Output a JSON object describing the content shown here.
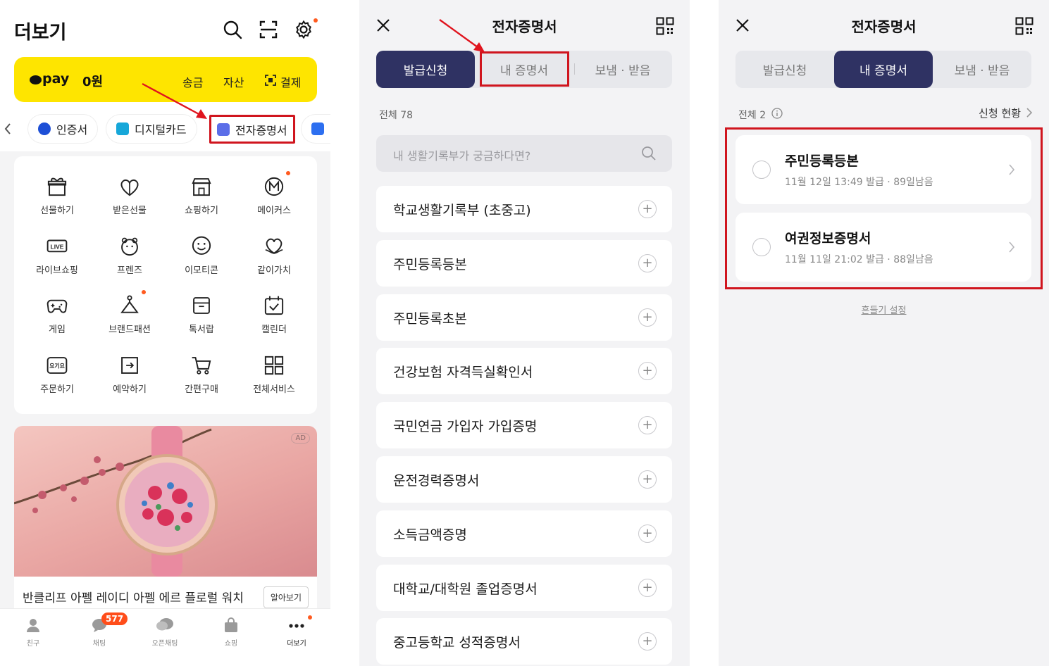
{
  "panel1": {
    "title": "더보기",
    "pay": {
      "logo": "pay",
      "amount": "0원",
      "links": [
        "송금",
        "자산",
        "결제"
      ]
    },
    "shortcuts": [
      "인증서",
      "디지털카드",
      "전자증명서"
    ],
    "grid": [
      {
        "label": "선물하기",
        "icon": "gift-icon"
      },
      {
        "label": "받은선물",
        "icon": "received-gift-icon"
      },
      {
        "label": "쇼핑하기",
        "icon": "store-icon"
      },
      {
        "label": "메이커스",
        "icon": "makers-icon"
      },
      {
        "label": "라이브쇼핑",
        "icon": "live-icon"
      },
      {
        "label": "프렌즈",
        "icon": "friends-icon"
      },
      {
        "label": "이모티콘",
        "icon": "emoticon-icon"
      },
      {
        "label": "같이가치",
        "icon": "heart-hands-icon"
      },
      {
        "label": "게임",
        "icon": "gamepad-icon"
      },
      {
        "label": "브랜드패션",
        "icon": "hanger-icon"
      },
      {
        "label": "톡서랍",
        "icon": "drawer-icon"
      },
      {
        "label": "캘린더",
        "icon": "calendar-icon"
      },
      {
        "label": "주문하기",
        "icon": "order-icon"
      },
      {
        "label": "예약하기",
        "icon": "reservation-icon"
      },
      {
        "label": "간편구매",
        "icon": "cart-icon"
      },
      {
        "label": "전체서비스",
        "icon": "all-services-icon"
      }
    ],
    "ad": {
      "badge": "AD",
      "text": "반클리프 아펠 레이디 아펠 에르 플로럴 워치",
      "button": "알아보기"
    },
    "tabs": [
      "친구",
      "채팅",
      "오픈채팅",
      "쇼핑",
      "더보기"
    ],
    "chat_badge": "577"
  },
  "panel2": {
    "title": "전자증명서",
    "segments": [
      "발급신청",
      "내 증명서",
      "보냄 · 받음"
    ],
    "count": "전체 78",
    "search_placeholder": "내 생활기록부가 궁금하다면?",
    "items": [
      "학교생활기록부 (초중고)",
      "주민등록등본",
      "주민등록초본",
      "건강보험 자격득실확인서",
      "국민연금 가입자 가입증명",
      "운전경력증명서",
      "소득금액증명",
      "대학교/대학원 졸업증명서",
      "중고등학교 성적증명서"
    ]
  },
  "panel3": {
    "title": "전자증명서",
    "segments": [
      "발급신청",
      "내 증명서",
      "보냄 · 받음"
    ],
    "count": "전체 2",
    "status_link": "신청 현황",
    "certs": [
      {
        "name": "주민등록등본",
        "sub": "11월 12일 13:49 발급 · 89일남음"
      },
      {
        "name": "여권정보증명서",
        "sub": "11월 11일 21:02 발급 · 88일남음"
      }
    ],
    "shake_setting": "흔들기 설정"
  },
  "colors": {
    "pay_yellow": "#fee500",
    "navy": "#2f3263",
    "highlight_red": "#d0151e",
    "badge_orange": "#ff4d1a"
  }
}
